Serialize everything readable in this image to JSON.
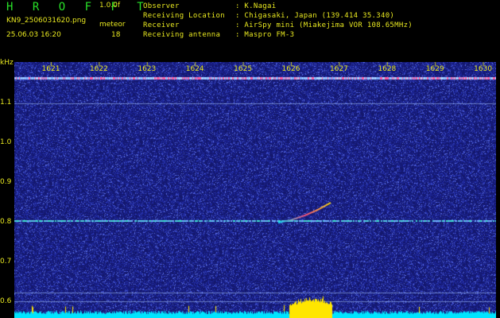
{
  "header": {
    "title": "H R O F F T",
    "version": "1.0.0f",
    "filename": "KN9_2506031620.png",
    "mode_label": "meteor",
    "datetime": "25.06.03 16:20",
    "count": "18",
    "observer_label": "Observer",
    "observer_value": ": K.Nagai",
    "location_label": "Receiving Location",
    "location_value": ": Chigasaki, Japan (139.414 35.340)",
    "receiver_label": "Receiver",
    "receiver_value": ": AirSpy mini (Miakejima VOR 108.65MHz)",
    "antenna_label": "Receiving antenna",
    "antenna_value": ": Maspro FM-3"
  },
  "y_axis_unit": "kHz",
  "x_ticks": [
    "1621",
    "1622",
    "1623",
    "1624",
    "1625",
    "1626",
    "1627",
    "1628",
    "1629",
    "1630"
  ],
  "y_ticks": [
    "1.1",
    "1.0",
    "0.9",
    "0.8",
    "0.7",
    "0.6"
  ],
  "colors": {
    "background_noise": "#1a1f8a",
    "label_text": "#e8e820",
    "title": "#28e028",
    "signal": "#00e5ff",
    "burst": "#ffe600"
  }
}
